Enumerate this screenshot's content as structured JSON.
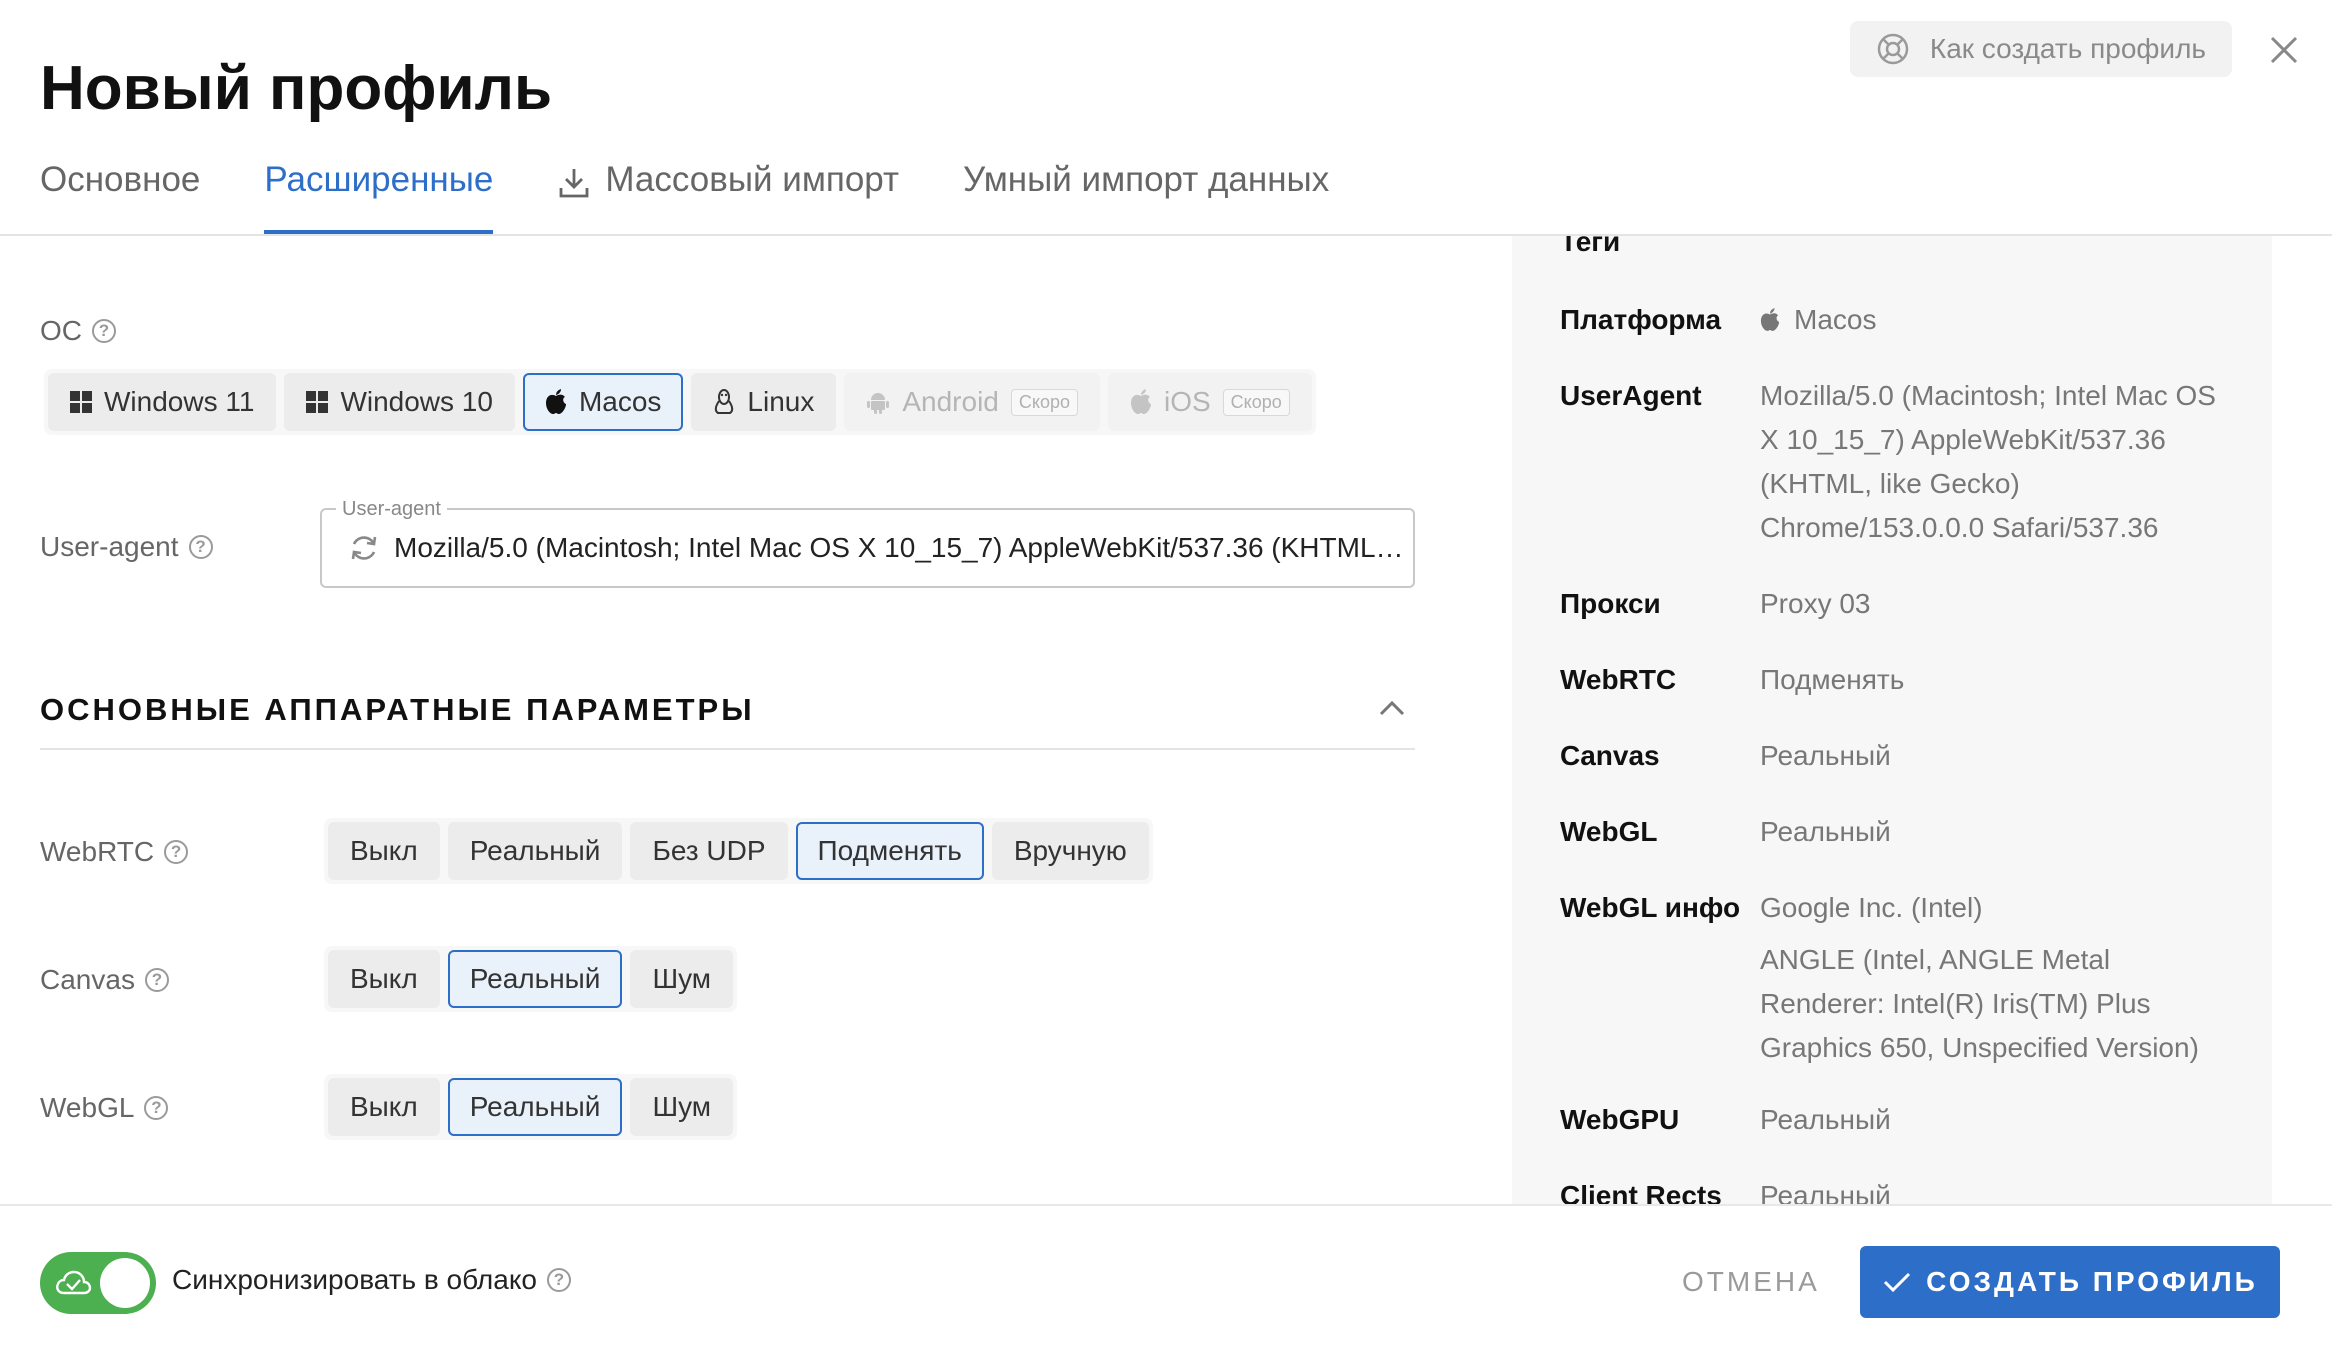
{
  "header": {
    "title": "Новый профиль",
    "help_label": "Как создать профиль"
  },
  "tabs": [
    {
      "label": "Основное",
      "active": false
    },
    {
      "label": "Расширенные",
      "active": true
    },
    {
      "label": "Массовый импорт",
      "active": false,
      "icon": "download-icon"
    },
    {
      "label": "Умный импорт данных",
      "active": false
    }
  ],
  "os": {
    "label": "ОС",
    "options": [
      {
        "label": "Windows 11",
        "icon": "windows-icon"
      },
      {
        "label": "Windows 10",
        "icon": "windows-icon"
      },
      {
        "label": "Macos",
        "icon": "apple-icon",
        "selected": true
      },
      {
        "label": "Linux",
        "icon": "linux-icon"
      },
      {
        "label": "Android",
        "icon": "android-icon",
        "badge": "Скоро",
        "disabled": true
      },
      {
        "label": "iOS",
        "icon": "apple-icon",
        "badge": "Скоро",
        "disabled": true
      }
    ]
  },
  "useragent": {
    "label": "User-agent",
    "legend": "User-agent",
    "value": "Mozilla/5.0 (Macintosh; Intel Mac OS X 10_15_7) AppleWebKit/537.36 (KHTML, like Gecko) Chrome/153.0.0.0 Safari/537.36"
  },
  "hardware": {
    "title": "ОСНОВНЫЕ АППАРАТНЫЕ ПАРАМЕТРЫ",
    "webrtc": {
      "label": "WebRTC",
      "options": [
        "Выкл",
        "Реальный",
        "Без UDP",
        "Подменять",
        "Вручную"
      ],
      "selected": 3
    },
    "canvas": {
      "label": "Canvas",
      "options": [
        "Выкл",
        "Реальный",
        "Шум"
      ],
      "selected": 1
    },
    "webgl": {
      "label": "WebGL",
      "options": [
        "Выкл",
        "Реальный",
        "Шум"
      ],
      "selected": 1
    }
  },
  "summary": {
    "tags_label": "Теги",
    "rows": [
      {
        "key": "Платформа",
        "value": "Macos",
        "icon": "apple-icon"
      },
      {
        "key": "UserAgent",
        "value": "Mozilla/5.0 (Macintosh; Intel Mac OS X 10_15_7) AppleWebKit/537.36 (KHTML, like Gecko) Chrome/153.0.0.0 Safari/537.36"
      },
      {
        "key": "Прокси",
        "value": "Proxy 03"
      },
      {
        "key": "WebRTC",
        "value": "Подменять"
      },
      {
        "key": "Canvas",
        "value": "Реальный"
      },
      {
        "key": "WebGL",
        "value": "Реальный"
      },
      {
        "key": "WebGL инфо",
        "value": "Google Inc. (Intel)",
        "value2": "ANGLE (Intel, ANGLE Metal Renderer: Intel(R) Iris(TM) Plus Graphics 650, Unspecified Version)"
      },
      {
        "key": "WebGPU",
        "value": "Реальный"
      },
      {
        "key": "Client Rects",
        "value": "Реальный"
      }
    ]
  },
  "footer": {
    "sync_label": "Синхронизировать в облако",
    "sync_enabled": true,
    "cancel_label": "ОТМЕНА",
    "create_label": "СОЗДАТЬ ПРОФИЛЬ"
  },
  "colors": {
    "accent": "#2d6ec8",
    "toggle_on": "#4caf50"
  }
}
